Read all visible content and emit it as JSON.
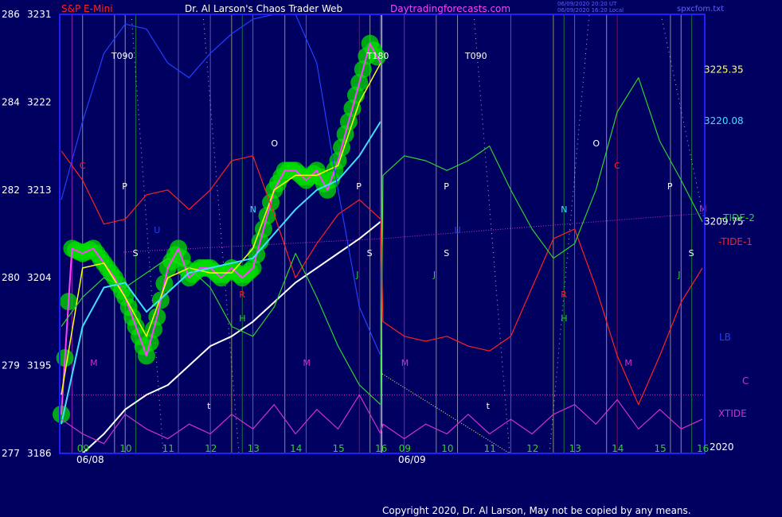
{
  "header": {
    "symbol": "S&P E-Mini",
    "title": "Dr. Al Larson's Chaos Trader Web",
    "site": "Daytradingforecasts.com",
    "stamp_line1": "06/09/2020 20:20 UT",
    "stamp_line2": "06/09/2020 16:20 Local",
    "file": "spxcfom.txt"
  },
  "copyright": "Copyright 2020, Dr. Al Larson, May not be copied by any means.",
  "colors": {
    "background": "#000060",
    "frame": "#2020ff",
    "price_bars": "#ff40ff",
    "glow": "#00dd00",
    "yellow_avg": "#ffff00",
    "cyan_avg": "#40e0ff",
    "white_avg": "#ffffff",
    "tide1": "#ff2020",
    "tide2": "#30d030",
    "lb": "#2040ff",
    "xtide": "#d030d0",
    "c_line": "#d030d0"
  },
  "chart_data": {
    "type": "line",
    "title": "S&P E-Mini",
    "left_axis_outer": [
      "286",
      "284",
      "282",
      "280",
      "279",
      "277"
    ],
    "left_axis_inner": [
      "3231",
      "3222",
      "3213",
      "3204",
      "3195",
      "3186"
    ],
    "ylim": [
      3186,
      3231
    ],
    "x_ticks": [
      "09",
      "10",
      "11",
      "12",
      "13",
      "14",
      "15",
      "16",
      "09",
      "10",
      "11",
      "12",
      "13",
      "14",
      "15",
      "16"
    ],
    "dates": [
      "06/08",
      "06/09"
    ],
    "right_levels": [
      {
        "label": "3225.35",
        "value": 3225.35,
        "color": "#ffff80"
      },
      {
        "label": "3220.08",
        "value": 3220.08,
        "color": "#40e0ff"
      },
      {
        "label": "3209.75",
        "value": 3209.75,
        "color": "#ffffff"
      }
    ],
    "right_labels": [
      {
        "label": "-TIDE-2",
        "color": "#30d030"
      },
      {
        "label": "-TIDE-1",
        "color": "#ff2020"
      },
      {
        "label": "LB",
        "color": "#2040ff"
      },
      {
        "label": "C",
        "color": "#d030d0"
      },
      {
        "label": "XTIDE",
        "color": "#d030d0"
      },
      {
        "label": "2020",
        "color": "#ffffff"
      }
    ],
    "markers": [
      {
        "text": "T090",
        "x": "06/08 09:45",
        "color": "#ffffff"
      },
      {
        "text": "T180",
        "x": "06/08 15:45",
        "color": "#ffffff"
      },
      {
        "text": "T090",
        "x": "06/09 10:30",
        "color": "#ffffff"
      },
      {
        "text": "C",
        "x": "06/08 09:00",
        "color": "#ff2020"
      },
      {
        "text": "P",
        "x": "06/08 10:00",
        "color": "#ffffff"
      },
      {
        "text": "U",
        "x": "06/08 10:45",
        "color": "#2040ff"
      },
      {
        "text": "S",
        "x": "06/08 10:15",
        "color": "#ffffff"
      },
      {
        "text": "M",
        "x": "06/08 09:15",
        "color": "#d030d0"
      },
      {
        "text": "N",
        "x": "06/08 13:00",
        "color": "#40e0ff"
      },
      {
        "text": "O",
        "x": "06/08 13:30",
        "color": "#ffffff"
      },
      {
        "text": "R",
        "x": "06/08 12:45",
        "color": "#ff2020"
      },
      {
        "text": "H",
        "x": "06/08 12:45",
        "color": "#30d030"
      },
      {
        "text": "M",
        "x": "06/08 14:15",
        "color": "#d030d0"
      },
      {
        "text": "t",
        "x": "06/08 12:00",
        "color": "#ffffff"
      },
      {
        "text": "P",
        "x": "06/08 15:30",
        "color": "#ffffff"
      },
      {
        "text": "S",
        "x": "06/08 15:45",
        "color": "#ffffff"
      },
      {
        "text": "J",
        "x": "06/08 15:30",
        "color": "#30d030"
      },
      {
        "text": "P",
        "x": "06/09 10:00",
        "color": "#ffffff"
      },
      {
        "text": "U",
        "x": "06/09 10:15",
        "color": "#2040ff"
      },
      {
        "text": "S",
        "x": "06/09 10:00",
        "color": "#ffffff"
      },
      {
        "text": "J",
        "x": "06/09 09:45",
        "color": "#30d030"
      },
      {
        "text": "M",
        "x": "06/09 09:00",
        "color": "#d030d0"
      },
      {
        "text": "t",
        "x": "06/09 11:00",
        "color": "#ffffff"
      },
      {
        "text": "N",
        "x": "06/09 12:45",
        "color": "#40e0ff"
      },
      {
        "text": "O",
        "x": "06/09 13:30",
        "color": "#ffffff"
      },
      {
        "text": "C",
        "x": "06/09 14:00",
        "color": "#ff2020"
      },
      {
        "text": "R",
        "x": "06/09 12:45",
        "color": "#ff2020"
      },
      {
        "text": "H",
        "x": "06/09 12:45",
        "color": "#30d030"
      },
      {
        "text": "M",
        "x": "06/09 14:15",
        "color": "#d030d0"
      },
      {
        "text": "P",
        "x": "06/09 15:15",
        "color": "#ffffff"
      },
      {
        "text": "J",
        "x": "06/09 15:30",
        "color": "#30d030"
      },
      {
        "text": "S",
        "x": "06/09 15:45",
        "color": "#ffffff"
      },
      {
        "text": "M",
        "x": "06/09 16:00",
        "color": "#d030d0"
      }
    ],
    "series": [
      {
        "name": "price",
        "color": "#ff40ff",
        "x": [
          "06/08 08:30",
          "06/08 08:45",
          "06/08 09:00",
          "06/08 09:15",
          "06/08 09:30",
          "06/08 09:45",
          "06/08 10:00",
          "06/08 10:15",
          "06/08 10:30",
          "06/08 10:45",
          "06/08 11:00",
          "06/08 11:15",
          "06/08 11:30",
          "06/08 11:45",
          "06/08 12:00",
          "06/08 12:15",
          "06/08 12:30",
          "06/08 12:45",
          "06/08 13:00",
          "06/08 13:15",
          "06/08 13:30",
          "06/08 13:45",
          "06/08 14:00",
          "06/08 14:15",
          "06/08 14:30",
          "06/08 14:45",
          "06/08 15:00",
          "06/08 15:15",
          "06/08 15:30",
          "06/08 15:45",
          "06/08 16:00"
        ],
        "values": [
          3190,
          3207,
          3206.5,
          3207,
          3205.5,
          3204,
          3202,
          3199,
          3196,
          3200,
          3205,
          3207,
          3204,
          3205,
          3205,
          3204,
          3205,
          3204,
          3205,
          3209,
          3213,
          3215,
          3215,
          3214,
          3215,
          3213,
          3216,
          3220,
          3224,
          3228,
          3226
        ]
      },
      {
        "name": "short average",
        "color": "#ffff00",
        "x": [
          "06/08 08:30",
          "06/08 09:00",
          "06/08 09:30",
          "06/08 10:00",
          "06/08 10:30",
          "06/08 11:00",
          "06/08 11:30",
          "06/08 12:00",
          "06/08 12:30",
          "06/08 13:00",
          "06/08 13:30",
          "06/08 14:00",
          "06/08 14:30",
          "06/08 15:00",
          "06/08 15:30",
          "06/08 16:00"
        ],
        "values": [
          3192,
          3205,
          3205.5,
          3202,
          3198,
          3204,
          3205,
          3204.5,
          3204.5,
          3207,
          3213,
          3214.5,
          3214.5,
          3215.5,
          3222,
          3226
        ]
      },
      {
        "name": "mid average",
        "color": "#40e0ff",
        "x": [
          "06/08 08:30",
          "06/08 09:00",
          "06/08 09:30",
          "06/08 10:00",
          "06/08 10:30",
          "06/08 11:00",
          "06/08 11:30",
          "06/08 12:00",
          "06/08 12:30",
          "06/08 13:00",
          "06/08 13:30",
          "06/08 14:00",
          "06/08 14:30",
          "06/08 15:00",
          "06/08 15:30",
          "06/08 16:00"
        ],
        "values": [
          3189,
          3199,
          3203,
          3203.5,
          3200.5,
          3202.5,
          3204.5,
          3205,
          3205.5,
          3206,
          3208.5,
          3211,
          3213,
          3214,
          3216.5,
          3220
        ]
      },
      {
        "name": "long average",
        "color": "#ffffff",
        "x": [
          "06/08 09:00",
          "06/08 09:30",
          "06/08 10:00",
          "06/08 10:30",
          "06/08 11:00",
          "06/08 11:30",
          "06/08 12:00",
          "06/08 12:30",
          "06/08 13:00",
          "06/08 13:30",
          "06/08 14:00",
          "06/08 14:30",
          "06/08 15:00",
          "06/08 15:30",
          "06/08 16:00"
        ],
        "values": [
          3186,
          3188,
          3190.5,
          3192,
          3193,
          3195,
          3197,
          3198,
          3199.5,
          3201.5,
          3203.5,
          3205,
          3206.5,
          3208,
          3209.75
        ]
      },
      {
        "name": "TIDE-1",
        "color": "#ff2020",
        "x": [
          "06/08 08:30",
          "06/08 09:00",
          "06/08 09:30",
          "06/08 10:00",
          "06/08 10:30",
          "06/08 11:00",
          "06/08 11:30",
          "06/08 12:00",
          "06/08 12:30",
          "06/08 13:00",
          "06/08 13:30",
          "06/08 14:00",
          "06/08 14:30",
          "06/08 15:00",
          "06/08 15:30",
          "06/08 16:00",
          "06/09 08:30",
          "06/09 09:00",
          "06/09 09:30",
          "06/09 10:00",
          "06/09 10:30",
          "06/09 11:00",
          "06/09 11:30",
          "06/09 12:00",
          "06/09 12:30",
          "06/09 13:00",
          "06/09 13:30",
          "06/09 14:00",
          "06/09 14:30",
          "06/09 15:00",
          "06/09 15:30",
          "06/09 16:00"
        ],
        "values": [
          3217,
          3214,
          3209.5,
          3210,
          3212.5,
          3213,
          3211,
          3213,
          3216,
          3216.5,
          3210.5,
          3204,
          3207.5,
          3210.5,
          3212,
          3210,
          3199.5,
          3198,
          3197.5,
          3198,
          3197,
          3196.5,
          3198,
          3203,
          3208,
          3209,
          3203,
          3196,
          3191,
          3196,
          3201.5,
          3205
        ]
      },
      {
        "name": "TIDE-2",
        "color": "#30d030",
        "x": [
          "06/08 08:30",
          "06/08 09:00",
          "06/08 09:30",
          "06/08 10:00",
          "06/08 10:30",
          "06/08 11:00",
          "06/08 11:30",
          "06/08 12:00",
          "06/08 12:30",
          "06/08 13:00",
          "06/08 13:30",
          "06/08 14:00",
          "06/08 14:30",
          "06/08 15:00",
          "06/08 15:30",
          "06/08 16:00",
          "06/09 08:30",
          "06/09 09:00",
          "06/09 09:30",
          "06/09 10:00",
          "06/09 10:30",
          "06/09 11:00",
          "06/09 11:30",
          "06/09 12:00",
          "06/09 12:30",
          "06/09 13:00",
          "06/09 13:30",
          "06/09 14:00",
          "06/09 14:30",
          "06/09 15:00",
          "06/09 15:30",
          "06/09 16:00"
        ],
        "values": [
          3199,
          3202,
          3204,
          3203,
          3204.5,
          3206,
          3205,
          3203,
          3199,
          3198,
          3201,
          3206.5,
          3202,
          3197,
          3193,
          3191,
          3214.5,
          3216.5,
          3216,
          3215,
          3216,
          3217.5,
          3213,
          3209,
          3206,
          3207.5,
          3213,
          3221,
          3224.5,
          3218,
          3214,
          3209.75
        ]
      },
      {
        "name": "LB",
        "color": "#2040ff",
        "x": [
          "06/08 08:30",
          "06/08 09:00",
          "06/08 09:30",
          "06/08 10:00",
          "06/08 10:30",
          "06/08 11:00",
          "06/08 11:30",
          "06/08 12:00",
          "06/08 12:30",
          "06/08 13:00",
          "06/08 13:30",
          "06/08 14:00",
          "06/08 14:30",
          "06/08 15:00",
          "06/08 15:30",
          "06/08 16:00"
        ],
        "values": [
          3212,
          3220,
          3227,
          3230,
          3229.5,
          3226,
          3224.5,
          3227,
          3229,
          3230.5,
          3231,
          3231,
          3226,
          3213,
          3201,
          3196
        ]
      },
      {
        "name": "XTIDE",
        "color": "#d030d0",
        "x": [
          "06/08 08:30",
          "06/08 09:00",
          "06/08 09:30",
          "06/08 10:00",
          "06/08 10:30",
          "06/08 11:00",
          "06/08 11:30",
          "06/08 12:00",
          "06/08 12:30",
          "06/08 13:00",
          "06/08 13:30",
          "06/08 14:00",
          "06/08 14:30",
          "06/08 15:00",
          "06/08 15:30",
          "06/08 16:00",
          "06/09 08:30",
          "06/09 09:00",
          "06/09 09:30",
          "06/09 10:00",
          "06/09 10:30",
          "06/09 11:00",
          "06/09 11:30",
          "06/09 12:00",
          "06/09 12:30",
          "06/09 13:00",
          "06/09 13:30",
          "06/09 14:00",
          "06/09 14:30",
          "06/09 15:00",
          "06/09 15:30",
          "06/09 16:00"
        ],
        "values": [
          3189.5,
          3188,
          3187,
          3190,
          3188.5,
          3187.5,
          3189,
          3188,
          3190,
          3188.5,
          3191,
          3188,
          3190.5,
          3188.5,
          3192,
          3188,
          3189,
          3187.5,
          3189,
          3188,
          3190,
          3188,
          3189.5,
          3188,
          3190,
          3191,
          3189,
          3191.5,
          3188.5,
          3190.5,
          3188.5,
          3189.5
        ]
      }
    ],
    "grid": true,
    "legend": "right"
  }
}
